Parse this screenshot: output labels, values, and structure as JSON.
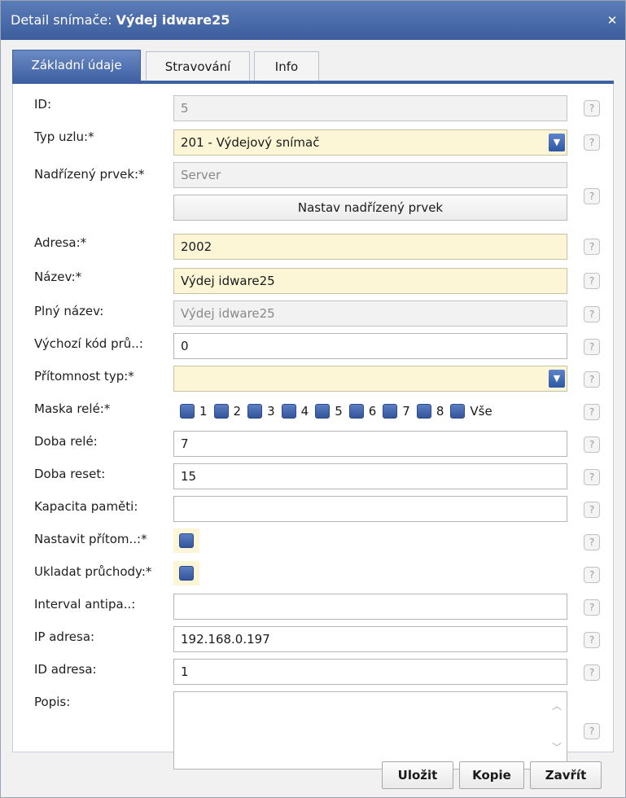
{
  "window": {
    "title_prefix": "Detail snímače:",
    "title_name": "Výdej idware25"
  },
  "tabs": [
    {
      "label": "Základní údaje"
    },
    {
      "label": "Stravování"
    },
    {
      "label": "Info"
    }
  ],
  "fields": {
    "id": {
      "label": "ID:",
      "value": "5"
    },
    "typ_uzlu": {
      "label": "Typ uzlu:*",
      "value": "201 - Výdejový snímač"
    },
    "nadrizeny": {
      "label": "Nadřízený prvek:*",
      "value": "Server",
      "button": "Nastav nadřízený prvek"
    },
    "adresa": {
      "label": "Adresa:*",
      "value": "2002"
    },
    "nazev": {
      "label": "Název:*",
      "value": "Výdej idware25"
    },
    "plny_nazev": {
      "label": "Plný název:",
      "value": "Výdej idware25"
    },
    "vychozi_kod": {
      "label": "Výchozí kód prů..:",
      "value": "0"
    },
    "pritomnost_typ": {
      "label": "Přítomnost typ:*",
      "value": ""
    },
    "maska_rele": {
      "label": "Maska relé:*",
      "options": [
        "1",
        "2",
        "3",
        "4",
        "5",
        "6",
        "7",
        "8",
        "Vše"
      ]
    },
    "doba_rele": {
      "label": "Doba relé:",
      "value": "7"
    },
    "doba_reset": {
      "label": "Doba reset:",
      "value": "15"
    },
    "kapacita": {
      "label": "Kapacita paměti:",
      "value": ""
    },
    "nastavit_pritom": {
      "label": "Nastavit přítom..:*"
    },
    "ukladat_pruchody": {
      "label": "Ukladat průchody:*"
    },
    "interval_antipa": {
      "label": "Interval antipa..:",
      "value": ""
    },
    "ip_adresa": {
      "label": "IP adresa:",
      "value": "192.168.0.197"
    },
    "id_adresa": {
      "label": "ID adresa:",
      "value": "1"
    },
    "popis": {
      "label": "Popis:",
      "value": ""
    }
  },
  "help_symbol": "?",
  "buttons": {
    "save": "Uložit",
    "copy": "Kopie",
    "close": "Zavřít"
  },
  "icons": {
    "close": "close-icon",
    "dropdown": "chevron-down-icon",
    "help": "help-icon"
  }
}
